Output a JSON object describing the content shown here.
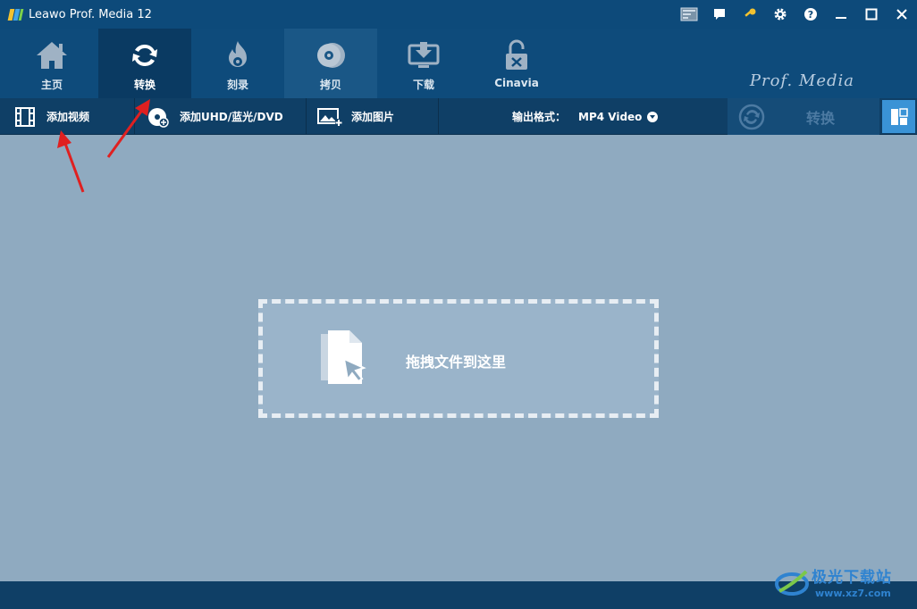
{
  "window": {
    "title": "Leawo Prof. Media 12"
  },
  "nav": {
    "items": [
      {
        "label": "主页",
        "icon": "home-icon"
      },
      {
        "label": "转换",
        "icon": "convert-icon"
      },
      {
        "label": "刻录",
        "icon": "burn-icon"
      },
      {
        "label": "拷贝",
        "icon": "copy-disc-icon"
      },
      {
        "label": "下载",
        "icon": "download-icon"
      },
      {
        "label": "Cinavia",
        "icon": "cinavia-unlock-icon"
      }
    ],
    "active": "转换",
    "brand": "Prof. Media"
  },
  "toolbar": {
    "add_video": "添加视频",
    "add_disc": "添加UHD/蓝光/DVD",
    "add_image": "添加图片",
    "output_format_label": "输出格式：",
    "output_format_value": "MP4 Video",
    "convert_label": "转换"
  },
  "dropzone": {
    "text": "拖拽文件到这里"
  },
  "watermark": {
    "title": "极光下载站",
    "url": "www.xz7.com"
  },
  "colors": {
    "titlebar": "#0d4a7a",
    "toolbar": "#0f3f66",
    "workspace": "#8faac0",
    "accent": "#3a93d6",
    "annotation_arrow": "#e02020"
  }
}
